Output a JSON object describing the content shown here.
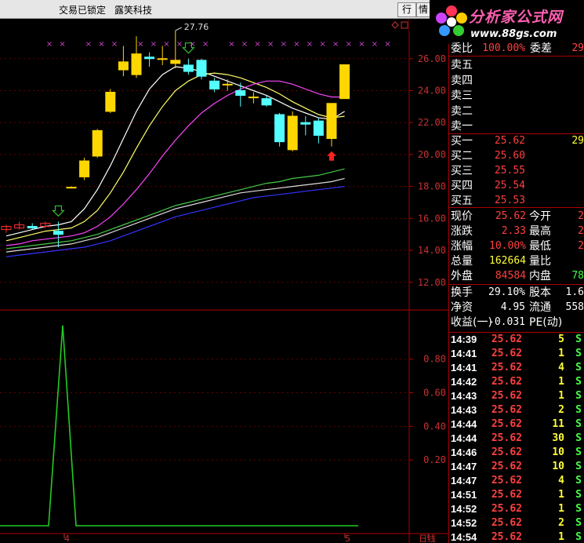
{
  "window": {
    "status": "交易已锁定",
    "stock_name": "露笑科技",
    "tab_buttons": [
      "行",
      "情"
    ]
  },
  "watermark": {
    "site_name": "分析家公式网",
    "url": "www.88gs.com"
  },
  "quote_panel": {
    "wei_bi_label": "委比",
    "wei_bi_value": "100.00%",
    "wei_cha_label": "委差",
    "wei_cha_value": "29",
    "sells": [
      {
        "label": "卖五",
        "price": "",
        "vol": ""
      },
      {
        "label": "卖四",
        "price": "",
        "vol": ""
      },
      {
        "label": "卖三",
        "price": "",
        "vol": ""
      },
      {
        "label": "卖二",
        "price": "",
        "vol": ""
      },
      {
        "label": "卖一",
        "price": "",
        "vol": ""
      }
    ],
    "buys": [
      {
        "label": "买一",
        "price": "25.62",
        "vol": "29"
      },
      {
        "label": "买二",
        "price": "25.60",
        "vol": ""
      },
      {
        "label": "买三",
        "price": "25.55",
        "vol": ""
      },
      {
        "label": "买四",
        "price": "25.54",
        "vol": ""
      },
      {
        "label": "买五",
        "price": "25.53",
        "vol": ""
      }
    ],
    "stats": [
      {
        "l1": "现价",
        "v1": "25.62",
        "l2": "今开",
        "v2": "2"
      },
      {
        "l1": "涨跌",
        "v1": "2.33",
        "l2": "最高",
        "v2": "2"
      },
      {
        "l1": "涨幅",
        "v1": "10.00%",
        "l2": "最低",
        "v2": "2"
      },
      {
        "l1": "总量",
        "v1": "162664",
        "l2": "量比",
        "v2": ""
      },
      {
        "l1": "外盘",
        "v1": "84584",
        "l2": "内盘",
        "v2": "78"
      }
    ],
    "fund": [
      {
        "l1": "换手",
        "v1": "29.10%",
        "l2": "股本",
        "v2": "1.6"
      },
      {
        "l1": "净资",
        "v1": "4.95",
        "l2": "流通",
        "v2": "558"
      },
      {
        "l1": "收益(一)",
        "v1": "-0.031",
        "l2": "PE(动)",
        "v2": ""
      }
    ],
    "ticks": [
      {
        "time": "14:39",
        "price": "25.62",
        "vol": "5",
        "bs": "S"
      },
      {
        "time": "14:41",
        "price": "25.62",
        "vol": "1",
        "bs": "S"
      },
      {
        "time": "14:41",
        "price": "25.62",
        "vol": "4",
        "bs": "S"
      },
      {
        "time": "14:42",
        "price": "25.62",
        "vol": "1",
        "bs": "S"
      },
      {
        "time": "14:43",
        "price": "25.62",
        "vol": "1",
        "bs": "S"
      },
      {
        "time": "14:43",
        "price": "25.62",
        "vol": "2",
        "bs": "S"
      },
      {
        "time": "14:44",
        "price": "25.62",
        "vol": "11",
        "bs": "S"
      },
      {
        "time": "14:44",
        "price": "25.62",
        "vol": "30",
        "bs": "S"
      },
      {
        "time": "14:46",
        "price": "25.62",
        "vol": "10",
        "bs": "S"
      },
      {
        "time": "14:47",
        "price": "25.62",
        "vol": "10",
        "bs": "S"
      },
      {
        "time": "14:47",
        "price": "25.62",
        "vol": "4",
        "bs": "S"
      },
      {
        "time": "14:51",
        "price": "25.62",
        "vol": "1",
        "bs": "S"
      },
      {
        "time": "14:52",
        "price": "25.62",
        "vol": "1",
        "bs": "S"
      },
      {
        "time": "14:52",
        "price": "25.62",
        "vol": "2",
        "bs": "S"
      },
      {
        "time": "14:54",
        "price": "25.62",
        "vol": "1",
        "bs": "S"
      }
    ]
  },
  "chart_data": [
    {
      "type": "candlestick",
      "y_ticks": [
        "26.00",
        "24.00",
        "22.00",
        "20.00",
        "18.00",
        "16.00",
        "14.00",
        "12.00"
      ],
      "ylim": [
        11.3,
        28.2
      ],
      "high_marker": "27.76",
      "candles": [
        {
          "o": 15.3,
          "h": 15.6,
          "l": 15.1,
          "c": 15.5
        },
        {
          "o": 15.4,
          "h": 15.8,
          "l": 15.3,
          "c": 15.6
        },
        {
          "o": 15.5,
          "h": 15.7,
          "l": 15.3,
          "c": 15.4
        },
        {
          "o": 15.5,
          "h": 15.8,
          "l": 15.4,
          "c": 15.7
        },
        {
          "o": 15.2,
          "h": 15.8,
          "l": 14.2,
          "c": 15.0
        },
        {
          "o": 17.9,
          "h": 18.0,
          "l": 17.9,
          "c": 17.95
        },
        {
          "o": 18.6,
          "h": 19.8,
          "l": 18.4,
          "c": 19.6
        },
        {
          "o": 19.9,
          "h": 21.6,
          "l": 19.8,
          "c": 21.5
        },
        {
          "o": 22.7,
          "h": 24.1,
          "l": 22.6,
          "c": 23.9
        },
        {
          "o": 25.3,
          "h": 26.8,
          "l": 24.9,
          "c": 25.8
        },
        {
          "o": 25.0,
          "h": 27.4,
          "l": 24.8,
          "c": 26.3
        },
        {
          "o": 26.1,
          "h": 26.4,
          "l": 25.5,
          "c": 26.0
        },
        {
          "o": 26.0,
          "h": 26.8,
          "l": 25.6,
          "c": 26.0
        },
        {
          "o": 25.7,
          "h": 27.76,
          "l": 25.4,
          "c": 25.9
        },
        {
          "o": 25.6,
          "h": 26.0,
          "l": 25.0,
          "c": 25.2
        },
        {
          "o": 25.9,
          "h": 26.0,
          "l": 24.7,
          "c": 24.9
        },
        {
          "o": 24.6,
          "h": 24.8,
          "l": 23.9,
          "c": 24.1
        },
        {
          "o": 24.4,
          "h": 24.7,
          "l": 24.0,
          "c": 24.4
        },
        {
          "o": 24.0,
          "h": 24.5,
          "l": 23.0,
          "c": 23.7
        },
        {
          "o": 23.6,
          "h": 23.9,
          "l": 23.2,
          "c": 23.6
        },
        {
          "o": 23.5,
          "h": 23.7,
          "l": 23.0,
          "c": 23.1
        },
        {
          "o": 22.5,
          "h": 22.6,
          "l": 20.5,
          "c": 20.8
        },
        {
          "o": 20.3,
          "h": 22.7,
          "l": 20.2,
          "c": 22.4
        },
        {
          "o": 22.0,
          "h": 22.4,
          "l": 21.2,
          "c": 21.9
        },
        {
          "o": 22.1,
          "h": 22.3,
          "l": 20.7,
          "c": 21.2
        },
        {
          "o": 21.0,
          "h": 23.2,
          "l": 20.5,
          "c": 23.2
        },
        {
          "o": 23.5,
          "h": 25.62,
          "l": 23.5,
          "c": 25.62
        }
      ],
      "ma_lines": [
        {
          "color": "#ffffff",
          "values": [
            14.9,
            15.1,
            15.3,
            15.5,
            15.6,
            15.8,
            16.6,
            17.8,
            19.3,
            21.0,
            22.7,
            24.1,
            25.0,
            25.5,
            25.4,
            25.2,
            24.9,
            24.6,
            24.3,
            24.0,
            23.7,
            23.3,
            22.9,
            22.6,
            22.3,
            22.2,
            22.7
          ]
        },
        {
          "color": "#ffff66",
          "values": [
            14.6,
            14.8,
            15.0,
            15.2,
            15.3,
            15.4,
            15.8,
            16.5,
            17.6,
            18.9,
            20.4,
            21.8,
            23.0,
            24.0,
            24.6,
            25.0,
            25.1,
            25.0,
            24.8,
            24.5,
            24.2,
            23.8,
            23.3,
            22.9,
            22.5,
            22.3,
            22.4
          ]
        },
        {
          "color": "#ff44ff",
          "values": [
            14.3,
            14.4,
            14.6,
            14.7,
            14.8,
            14.9,
            15.1,
            15.5,
            16.1,
            16.9,
            17.8,
            18.8,
            19.9,
            20.9,
            21.8,
            22.6,
            23.2,
            23.7,
            24.1,
            24.4,
            24.6,
            24.6,
            24.4,
            24.1,
            23.8,
            23.6,
            23.6
          ]
        },
        {
          "color": "#44cc44",
          "values": [
            14.1,
            14.2,
            14.3,
            14.4,
            14.5,
            14.6,
            14.8,
            15.0,
            15.3,
            15.6,
            15.9,
            16.2,
            16.5,
            16.8,
            17.0,
            17.2,
            17.4,
            17.6,
            17.8,
            18.0,
            18.2,
            18.3,
            18.5,
            18.6,
            18.7,
            18.9,
            19.1
          ]
        },
        {
          "color": "#dddddd",
          "values": [
            13.9,
            14.0,
            14.1,
            14.2,
            14.3,
            14.4,
            14.6,
            14.8,
            15.1,
            15.4,
            15.7,
            16.0,
            16.3,
            16.6,
            16.8,
            17.0,
            17.2,
            17.4,
            17.6,
            17.7,
            17.8,
            17.9,
            18.0,
            18.1,
            18.2,
            18.3,
            18.5
          ]
        },
        {
          "color": "#3333ff",
          "values": [
            13.6,
            13.7,
            13.8,
            13.9,
            14.0,
            14.1,
            14.2,
            14.4,
            14.6,
            14.9,
            15.2,
            15.5,
            15.8,
            16.1,
            16.3,
            16.5,
            16.7,
            16.9,
            17.1,
            17.3,
            17.4,
            17.5,
            17.6,
            17.7,
            17.8,
            17.9,
            18.0
          ]
        }
      ]
    },
    {
      "type": "line",
      "y_ticks": [
        "0.80",
        "0.60",
        "0.40",
        "0.20"
      ],
      "ylim": [
        -0.2,
        1.05
      ],
      "x_labels": [
        "4",
        "5",
        "日线"
      ],
      "series": [
        {
          "values": [
            0,
            0,
            0,
            0,
            1,
            0,
            0,
            0,
            0,
            0,
            0,
            0,
            0,
            0,
            0,
            0,
            0,
            0,
            0,
            0,
            0,
            0,
            0,
            0,
            0,
            0,
            0
          ],
          "color": "#22cc22"
        }
      ]
    }
  ]
}
